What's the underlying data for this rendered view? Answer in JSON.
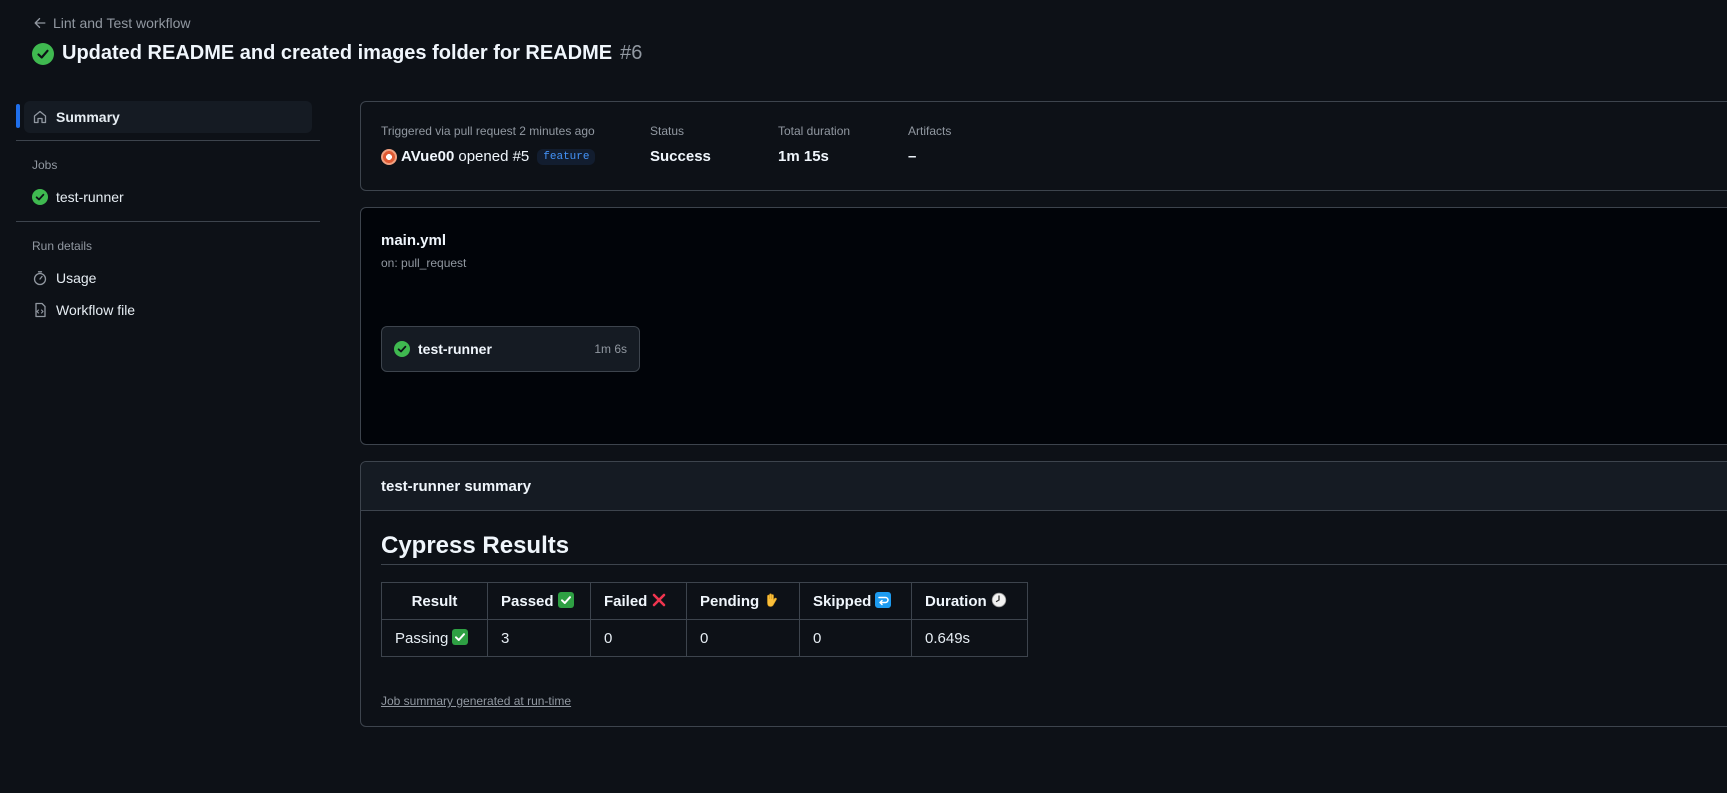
{
  "header": {
    "back_link": "Lint and Test workflow",
    "title": "Updated README and created images folder for README",
    "run_number": "#6"
  },
  "sidebar": {
    "summary_label": "Summary",
    "jobs_heading": "Jobs",
    "jobs": [
      {
        "label": "test-runner"
      }
    ],
    "run_details_heading": "Run details",
    "usage_label": "Usage",
    "workflow_file_label": "Workflow file"
  },
  "info": {
    "triggered_label": "Triggered via pull request 2 minutes ago",
    "actor": "AVue00",
    "opened_text": "opened #5",
    "branch": "feature",
    "status_label": "Status",
    "status_value": "Success",
    "duration_label": "Total duration",
    "duration_value": "1m 15s",
    "artifacts_label": "Artifacts",
    "artifacts_value": "–"
  },
  "graph": {
    "file": "main.yml",
    "trigger": "on: pull_request",
    "job_name": "test-runner",
    "job_duration": "1m 6s"
  },
  "summary": {
    "heading": "test-runner summary",
    "title": "Cypress Results",
    "columns": [
      "Result",
      "Passed",
      "Failed",
      "Pending",
      "Skipped",
      "Duration"
    ],
    "column_icons": [
      "",
      "check-mark-button-icon",
      "cross-mark-icon",
      "raised-hand-icon",
      "return-arrow-icon",
      "clock-icon"
    ],
    "row": {
      "result": "Passing",
      "passed": "3",
      "failed": "0",
      "pending": "0",
      "skipped": "0",
      "duration": "0.649s"
    },
    "footer": "Job summary generated at run-time"
  },
  "colors": {
    "background": "#0d1117",
    "success": "#3fb950",
    "accent": "#1f6feb",
    "branch_text": "#4493f8"
  }
}
